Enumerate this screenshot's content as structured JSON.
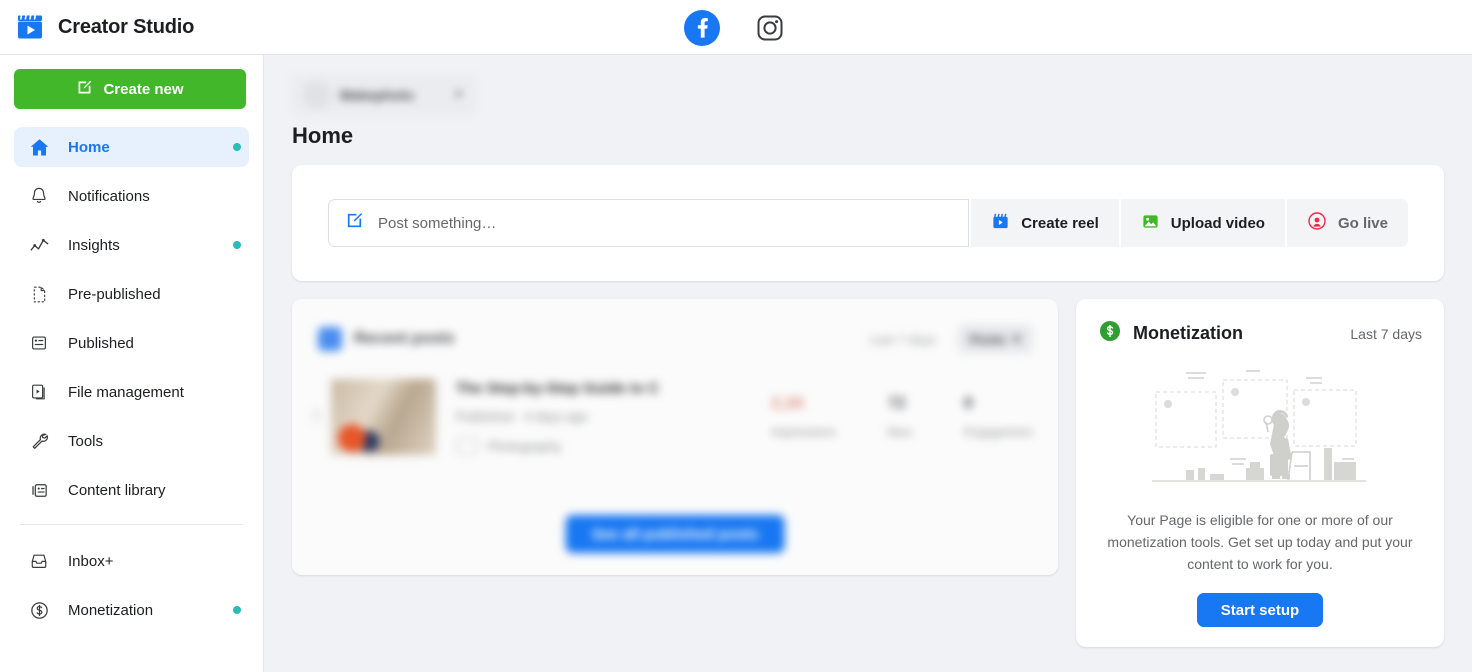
{
  "app": {
    "title": "Creator Studio",
    "logo_icon": "clapperboard-icon"
  },
  "platform_switch": {
    "items": [
      {
        "icon": "facebook-icon",
        "name": "Facebook",
        "active": true
      },
      {
        "icon": "instagram-icon",
        "name": "Instagram",
        "active": false
      }
    ]
  },
  "sidebar": {
    "create_button": {
      "label": "Create new",
      "icon": "compose-icon"
    },
    "items": [
      {
        "label": "Home",
        "icon": "home-icon",
        "active": true,
        "badge": true
      },
      {
        "label": "Notifications",
        "icon": "bell-icon",
        "active": false,
        "badge": false
      },
      {
        "label": "Insights",
        "icon": "chart-line-icon",
        "active": false,
        "badge": true
      },
      {
        "label": "Pre-published",
        "icon": "document-icon",
        "active": false,
        "badge": false
      },
      {
        "label": "Published",
        "icon": "article-icon",
        "active": false,
        "badge": false
      },
      {
        "label": "File management",
        "icon": "media-files-icon",
        "active": false,
        "badge": false
      },
      {
        "label": "Tools",
        "icon": "wrench-icon",
        "active": false,
        "badge": false
      },
      {
        "label": "Content library",
        "icon": "library-icon",
        "active": false,
        "badge": false
      }
    ],
    "items_secondary": [
      {
        "label": "Inbox+",
        "icon": "inbox-icon",
        "active": false,
        "badge": false
      },
      {
        "label": "Monetization",
        "icon": "dollar-circle-icon",
        "active": false,
        "badge": true
      }
    ]
  },
  "page_selector": {
    "name": "Makephoto",
    "caret_icon": "chevron-down-icon",
    "blurred": true
  },
  "main": {
    "page_title": "Home",
    "composer": {
      "placeholder": "Post something…",
      "icon": "compose-icon",
      "actions": [
        {
          "label": "Create reel",
          "icon": "reel-icon"
        },
        {
          "label": "Upload video",
          "icon": "image-icon"
        },
        {
          "label": "Go live",
          "icon": "broadcast-icon",
          "dim": true
        }
      ]
    },
    "recent_posts": {
      "blurred": true,
      "title": "Recent posts",
      "range": "Last 7 days",
      "filter": "Posts",
      "filter_caret_icon": "chevron-down-icon",
      "post": {
        "title": "The Step-by-Step Guide to C",
        "subtitle": "Published · 4 days ago",
        "tag": "Photography",
        "metrics": [
          {
            "value": "2,1K",
            "label": "Impressions"
          },
          {
            "value": "72",
            "label": "likes"
          },
          {
            "value": "8",
            "label": "Engagement"
          }
        ]
      },
      "see_all_label": "See all published posts"
    },
    "monetization": {
      "title": "Monetization",
      "icon": "dollar-circle-icon",
      "range": "Last 7 days",
      "illustration": "gallery-person-illustration",
      "description": "Your Page is eligible for one or more of our monetization tools. Get set up today and put your content to work for you.",
      "cta_label": "Start setup"
    }
  },
  "colors": {
    "brand_blue": "#1877f2",
    "green": "#42b72a",
    "badge_teal": "#2abbbb",
    "page_bg": "#f0f2f5",
    "text_primary": "#1c1e21",
    "text_secondary": "#65676b"
  }
}
